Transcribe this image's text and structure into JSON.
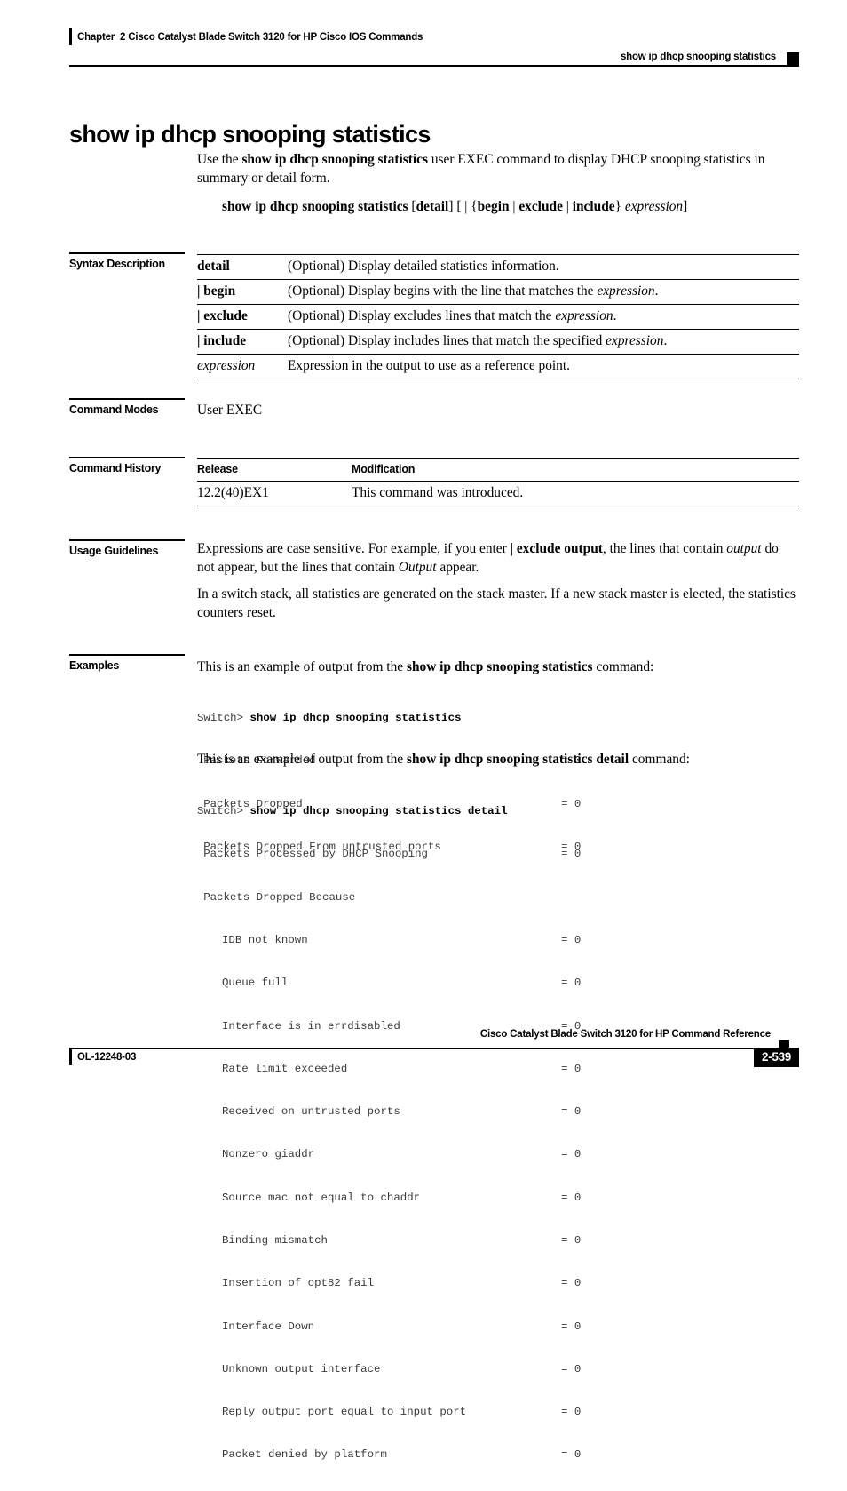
{
  "header": {
    "chapter": "Chapter  2 Cisco Catalyst Blade Switch 3120 for HP Cisco IOS Commands",
    "running_title": "show ip dhcp snooping statistics"
  },
  "title": "show ip dhcp snooping statistics",
  "intro": {
    "before": "Use the ",
    "command": "show ip dhcp snooping statistics",
    "after": " user EXEC command to display DHCP snooping statistics in summary or detail form."
  },
  "syntax": {
    "command": "show ip dhcp snooping statistics",
    "optional_detail": "[detail]",
    "pipe_group": "[ | {begin | exclude | include} ",
    "expression": "expression",
    "closing": "]"
  },
  "sections": {
    "syntax_description": "Syntax Description",
    "command_modes": "Command Modes",
    "command_history": "Command History",
    "usage_guidelines": "Usage Guidelines",
    "examples": "Examples"
  },
  "syntax_table": [
    {
      "term": "detail",
      "term_style": "bold",
      "desc_before": "(Optional) Display detailed statistics information.",
      "desc_italic": "",
      "desc_after": ""
    },
    {
      "term": "| begin",
      "term_style": "bold",
      "desc_before": "(Optional) Display begins with the line that matches the ",
      "desc_italic": "expression",
      "desc_after": "."
    },
    {
      "term": "| exclude",
      "term_style": "bold",
      "desc_before": "(Optional) Display excludes lines that match the ",
      "desc_italic": "expression",
      "desc_after": "."
    },
    {
      "term": "| include",
      "term_style": "bold",
      "desc_before": "(Optional) Display includes lines that match the specified ",
      "desc_italic": "expression",
      "desc_after": "."
    },
    {
      "term": "expression",
      "term_style": "italic",
      "desc_before": "Expression in the output to use as a reference point.",
      "desc_italic": "",
      "desc_after": ""
    }
  ],
  "command_modes_value": "User EXEC",
  "history_table": {
    "headers": {
      "release": "Release",
      "modification": "Modification"
    },
    "rows": [
      {
        "release": "12.2(40)EX1",
        "modification": "This command was introduced."
      }
    ]
  },
  "usage": {
    "p1_a": "Expressions are case sensitive. For example, if you enter ",
    "p1_b": "| exclude output",
    "p1_c": ", the lines that contain ",
    "p1_d": "output",
    "p1_e": " do not appear, but the lines that contain ",
    "p1_f": "Output",
    "p1_g": " appear.",
    "p2": "In a switch stack, all statistics are generated on the stack master. If a new stack master is elected, the statistics counters reset."
  },
  "examples": {
    "intro1_before": "This is an example of output from the ",
    "intro1_command": "show ip dhcp snooping statistics",
    "intro1_after": " command:",
    "intro2_before": "This is an example of output from the ",
    "intro2_command": "show ip dhcp snooping statistics detail",
    "intro2_after": " command:",
    "prompt": "Switch>",
    "cmd1": "show ip dhcp snooping statistics",
    "cmd2": "show ip dhcp snooping statistics detail",
    "output1": [
      {
        "name": "Packets Forwarded",
        "value": "= 0",
        "indent": 1
      },
      {
        "name": "Packets Dropped",
        "value": "= 0",
        "indent": 1
      },
      {
        "name": "Packets Dropped From untrusted ports",
        "value": "= 0",
        "indent": 1
      }
    ],
    "output2": [
      {
        "name": "Packets Processed by DHCP Snooping",
        "value": "= 0",
        "indent": 1
      },
      {
        "name": "Packets Dropped Because",
        "value": "",
        "indent": 1
      },
      {
        "name": "IDB not known",
        "value": "= 0",
        "indent": 2
      },
      {
        "name": "Queue full",
        "value": "= 0",
        "indent": 2
      },
      {
        "name": "Interface is in errdisabled",
        "value": "= 0",
        "indent": 2
      },
      {
        "name": "Rate limit exceeded",
        "value": "= 0",
        "indent": 2
      },
      {
        "name": "Received on untrusted ports",
        "value": "= 0",
        "indent": 2
      },
      {
        "name": "Nonzero giaddr",
        "value": "= 0",
        "indent": 2
      },
      {
        "name": "Source mac not equal to chaddr",
        "value": "= 0",
        "indent": 2
      },
      {
        "name": "Binding mismatch",
        "value": "= 0",
        "indent": 2
      },
      {
        "name": "Insertion of opt82 fail",
        "value": "= 0",
        "indent": 2
      },
      {
        "name": "Interface Down",
        "value": "= 0",
        "indent": 2
      },
      {
        "name": "Unknown output interface",
        "value": "= 0",
        "indent": 2
      },
      {
        "name": "Reply output port equal to input port",
        "value": "= 0",
        "indent": 2
      },
      {
        "name": "Packet denied by platform",
        "value": "= 0",
        "indent": 2
      }
    ]
  },
  "footer": {
    "title": "Cisco Catalyst Blade Switch 3120 for HP Command Reference",
    "doc_id": "OL-12248-03",
    "page_number": "2-539"
  }
}
